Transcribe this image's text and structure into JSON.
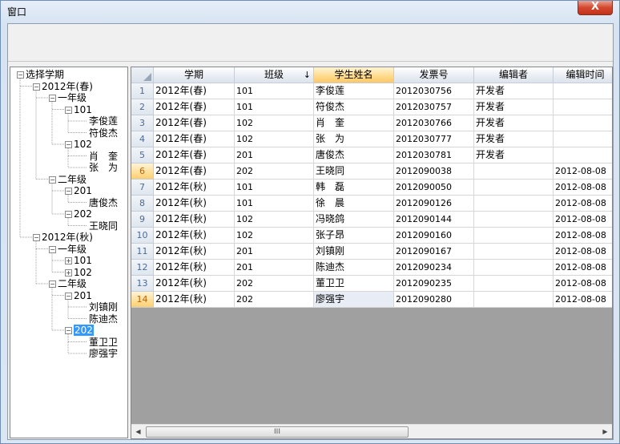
{
  "window": {
    "title": "窗口",
    "close_label": "X"
  },
  "tree": {
    "nodes": [
      {
        "label": "选择学期",
        "level": 0,
        "expander": "−"
      },
      {
        "label": "2012年(春)",
        "level": 1,
        "expander": "−"
      },
      {
        "label": "一年级",
        "level": 2,
        "expander": "−"
      },
      {
        "label": "101",
        "level": 3,
        "expander": "−"
      },
      {
        "label": "李俊莲",
        "level": 4,
        "expander": ""
      },
      {
        "label": "符俊杰",
        "level": 4,
        "expander": ""
      },
      {
        "label": "102",
        "level": 3,
        "expander": "−"
      },
      {
        "label": "肖　奎",
        "level": 4,
        "expander": ""
      },
      {
        "label": "张　为",
        "level": 4,
        "expander": ""
      },
      {
        "label": "二年级",
        "level": 2,
        "expander": "−"
      },
      {
        "label": "201",
        "level": 3,
        "expander": "−"
      },
      {
        "label": "唐俊杰",
        "level": 4,
        "expander": ""
      },
      {
        "label": "202",
        "level": 3,
        "expander": "−"
      },
      {
        "label": "王晓同",
        "level": 4,
        "expander": ""
      },
      {
        "label": "2012年(秋)",
        "level": 1,
        "expander": "−"
      },
      {
        "label": "一年级",
        "level": 2,
        "expander": "−"
      },
      {
        "label": "101",
        "level": 3,
        "expander": "+"
      },
      {
        "label": "102",
        "level": 3,
        "expander": "+"
      },
      {
        "label": "二年级",
        "level": 2,
        "expander": "−"
      },
      {
        "label": "201",
        "level": 3,
        "expander": "−"
      },
      {
        "label": "刘镇刚",
        "level": 4,
        "expander": ""
      },
      {
        "label": "陈迪杰",
        "level": 4,
        "expander": ""
      },
      {
        "label": "202",
        "level": 3,
        "expander": "−",
        "selected": true
      },
      {
        "label": "董卫卫",
        "level": 4,
        "expander": ""
      },
      {
        "label": "廖强宇",
        "level": 4,
        "expander": ""
      }
    ]
  },
  "grid": {
    "columns": [
      "学期",
      "班级",
      "学生姓名",
      "发票号",
      "编辑者",
      "编辑时间"
    ],
    "sorted_column_arrow": "↓",
    "rows": [
      {
        "n": "1",
        "term": "2012年(春)",
        "class": "101",
        "name": "李俊莲",
        "invoice": "2012030756",
        "editor": "开发者",
        "time": ""
      },
      {
        "n": "2",
        "term": "2012年(春)",
        "class": "101",
        "name": "符俊杰",
        "invoice": "2012030757",
        "editor": "开发者",
        "time": ""
      },
      {
        "n": "3",
        "term": "2012年(春)",
        "class": "102",
        "name": "肖　奎",
        "invoice": "2012030766",
        "editor": "开发者",
        "time": ""
      },
      {
        "n": "4",
        "term": "2012年(春)",
        "class": "102",
        "name": "张　为",
        "invoice": "2012030777",
        "editor": "开发者",
        "time": ""
      },
      {
        "n": "5",
        "term": "2012年(春)",
        "class": "201",
        "name": "唐俊杰",
        "invoice": "2012030781",
        "editor": "开发者",
        "time": ""
      },
      {
        "n": "6",
        "term": "2012年(春)",
        "class": "202",
        "name": "王晓同",
        "invoice": "2012090038",
        "editor": "",
        "time": "2012-08-08"
      },
      {
        "n": "7",
        "term": "2012年(秋)",
        "class": "101",
        "name": "韩　磊",
        "invoice": "2012090050",
        "editor": "",
        "time": "2012-08-08"
      },
      {
        "n": "8",
        "term": "2012年(秋)",
        "class": "101",
        "name": "徐　晨",
        "invoice": "2012090126",
        "editor": "",
        "time": "2012-08-08"
      },
      {
        "n": "9",
        "term": "2012年(秋)",
        "class": "102",
        "name": "冯晓鸽",
        "invoice": "2012090144",
        "editor": "",
        "time": "2012-08-08"
      },
      {
        "n": "10",
        "term": "2012年(秋)",
        "class": "102",
        "name": "张子昂",
        "invoice": "2012090160",
        "editor": "",
        "time": "2012-08-08"
      },
      {
        "n": "11",
        "term": "2012年(秋)",
        "class": "201",
        "name": "刘镇刚",
        "invoice": "2012090167",
        "editor": "",
        "time": "2012-08-08"
      },
      {
        "n": "12",
        "term": "2012年(秋)",
        "class": "201",
        "name": "陈迪杰",
        "invoice": "2012090234",
        "editor": "",
        "time": "2012-08-08"
      },
      {
        "n": "13",
        "term": "2012年(秋)",
        "class": "202",
        "name": "董卫卫",
        "invoice": "2012090235",
        "editor": "",
        "time": "2012-08-08"
      },
      {
        "n": "14",
        "term": "2012年(秋)",
        "class": "202",
        "name": "廖强宇",
        "invoice": "2012090280",
        "editor": "",
        "time": "2012-08-08"
      }
    ],
    "active_row": "6",
    "current_row": "14"
  },
  "scrollbar": {
    "left_arrow": "◀",
    "right_arrow": "▶",
    "thumb_grip": "III"
  }
}
